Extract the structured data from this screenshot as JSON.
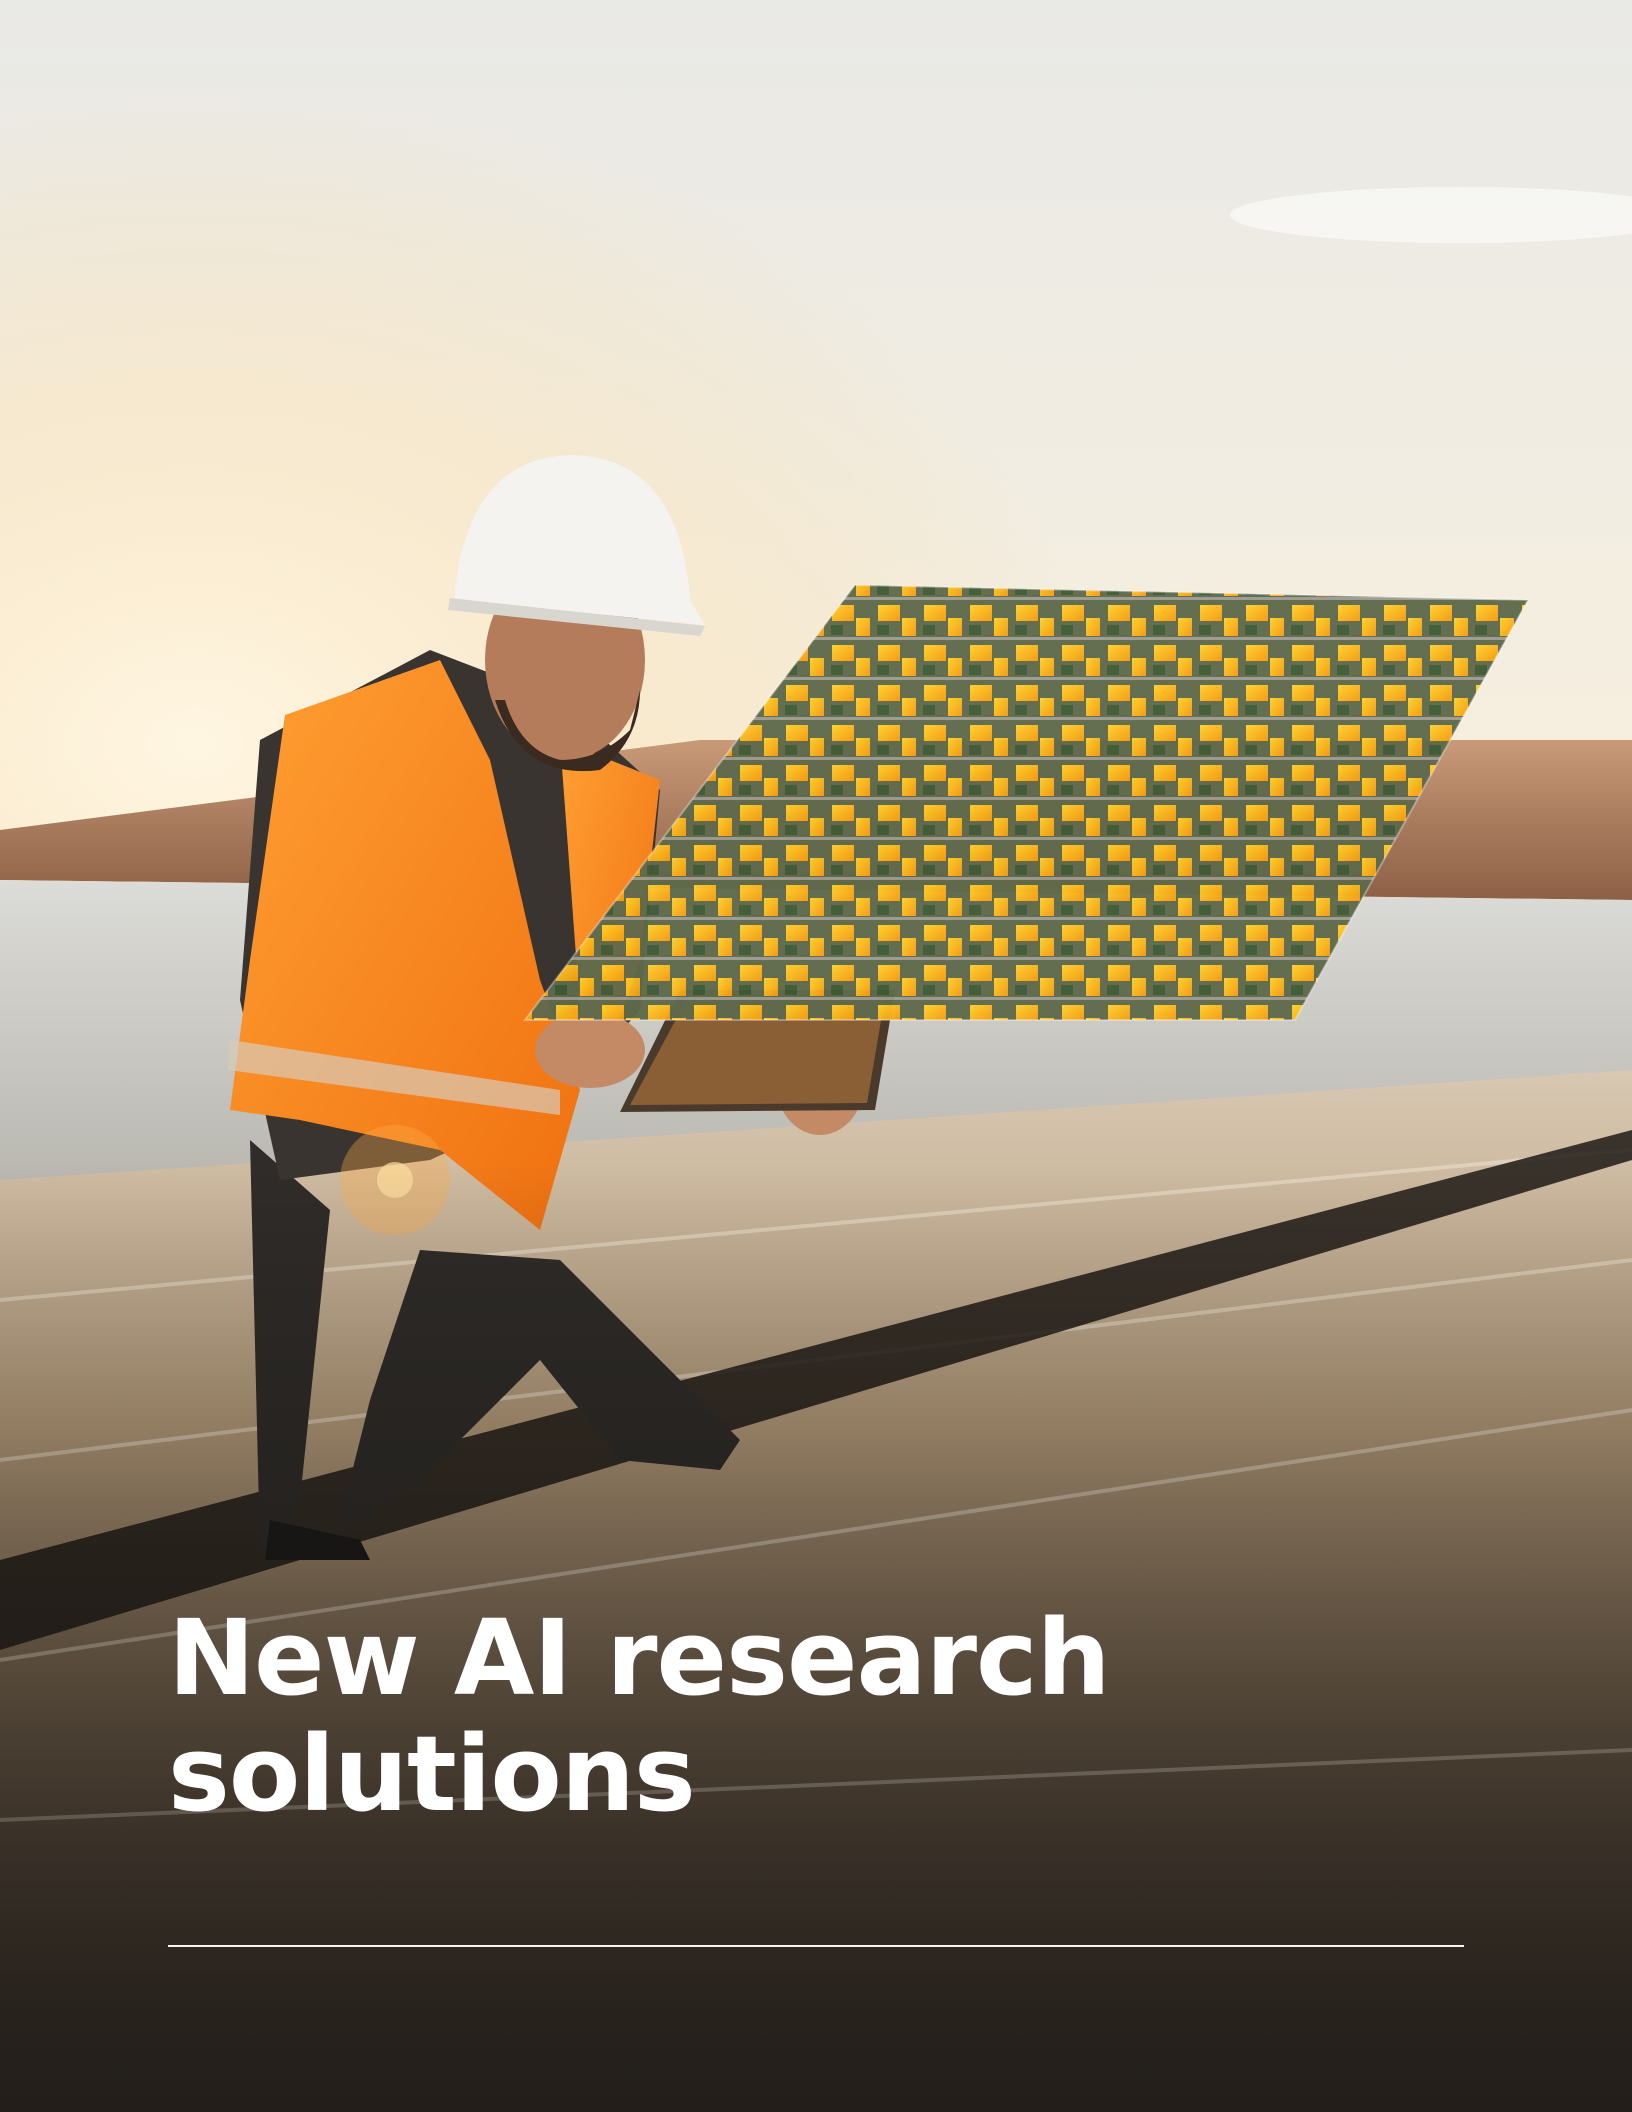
{
  "hero": {
    "headline_line1": "New AI research",
    "headline_line2": "solutions"
  },
  "colors": {
    "headline": "#ffffff",
    "rule": "#ffffff",
    "vest": "#ff8c1a",
    "sky": "#f6e9cf",
    "rooftop_overlay": "#ffc21a"
  },
  "icons": []
}
